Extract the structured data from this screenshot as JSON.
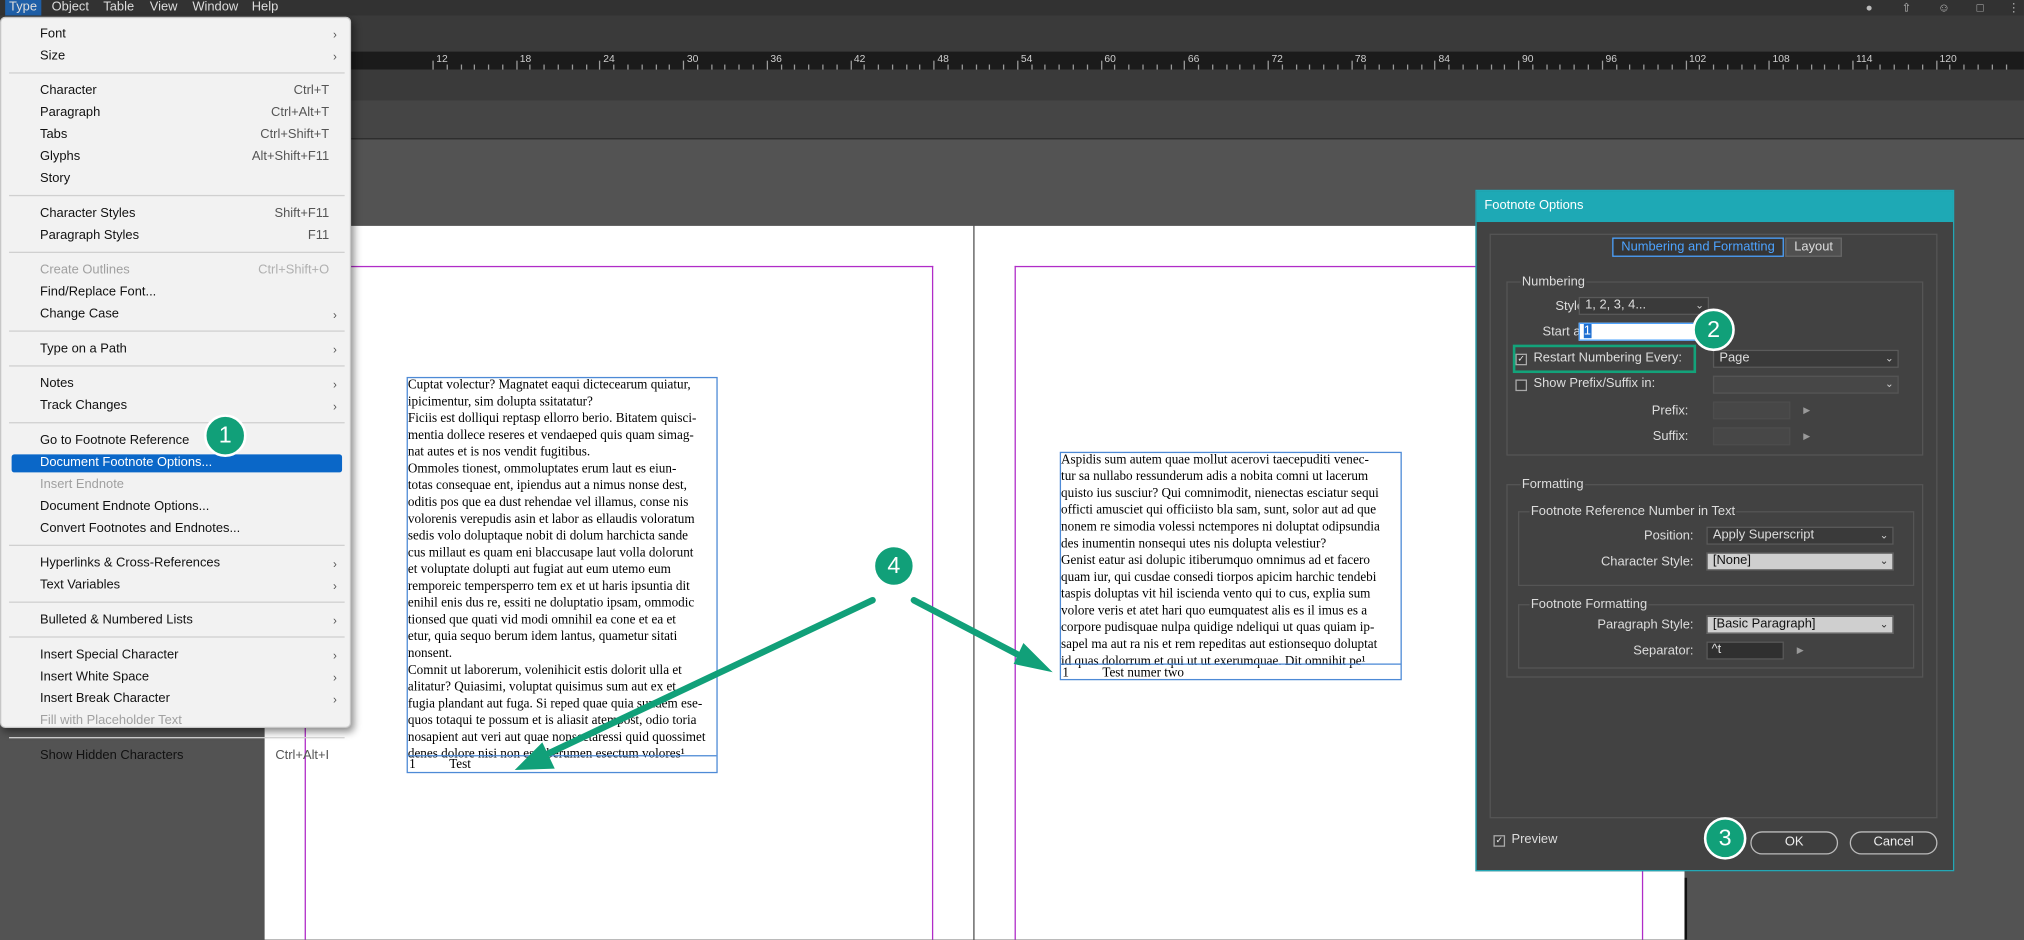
{
  "menubar": {
    "items": [
      "Type",
      "Object",
      "Table",
      "View",
      "Window",
      "Help"
    ]
  },
  "ruler": {
    "labels": [
      "12",
      "18",
      "24",
      "30",
      "36",
      "42",
      "48",
      "54",
      "60",
      "66",
      "72",
      "78",
      "84",
      "90",
      "96",
      "102",
      "108",
      "114",
      "120"
    ]
  },
  "type_menu": {
    "items": [
      {
        "label": "Font",
        "submenu": true
      },
      {
        "label": "Size",
        "submenu": true
      },
      {
        "divider": true
      },
      {
        "label": "Character",
        "shortcut": "Ctrl+T"
      },
      {
        "label": "Paragraph",
        "shortcut": "Ctrl+Alt+T"
      },
      {
        "label": "Tabs",
        "shortcut": "Ctrl+Shift+T"
      },
      {
        "label": "Glyphs",
        "shortcut": "Alt+Shift+F11"
      },
      {
        "label": "Story"
      },
      {
        "divider": true
      },
      {
        "label": "Character Styles",
        "shortcut": "Shift+F11"
      },
      {
        "label": "Paragraph Styles",
        "shortcut": "F11"
      },
      {
        "divider": true
      },
      {
        "label": "Create Outlines",
        "shortcut": "Ctrl+Shift+O",
        "disabled": true
      },
      {
        "label": "Find/Replace Font..."
      },
      {
        "label": "Change Case",
        "submenu": true
      },
      {
        "divider": true
      },
      {
        "label": "Type on a Path",
        "submenu": true
      },
      {
        "divider": true
      },
      {
        "label": "Notes",
        "submenu": true
      },
      {
        "label": "Track Changes",
        "submenu": true
      },
      {
        "divider": true
      },
      {
        "label": "Go to Footnote Reference"
      },
      {
        "label": "Document Footnote Options...",
        "highlighted": true
      },
      {
        "label": "Insert Endnote",
        "disabled": true
      },
      {
        "label": "Document Endnote Options..."
      },
      {
        "label": "Convert Footnotes and Endnotes..."
      },
      {
        "divider": true
      },
      {
        "label": "Hyperlinks & Cross-References",
        "submenu": true
      },
      {
        "label": "Text Variables",
        "submenu": true
      },
      {
        "divider": true
      },
      {
        "label": "Bulleted & Numbered Lists",
        "submenu": true
      },
      {
        "divider": true
      },
      {
        "label": "Insert Special Character",
        "submenu": true
      },
      {
        "label": "Insert White Space",
        "submenu": true
      },
      {
        "label": "Insert Break Character",
        "submenu": true
      },
      {
        "label": "Fill with Placeholder Text",
        "disabled": true
      },
      {
        "divider": true
      },
      {
        "label": "Show Hidden Characters",
        "shortcut": "Ctrl+Alt+I"
      }
    ]
  },
  "left_page": {
    "text": "Cuptat volectur? Magnatet eaqui dictecearum quiatur,\nipicimentur, sim dolupta ssitatatur?\nFiciis est dolliqui reptasp ellorro berio. Bitatem quisci-\nmentia dollece reseres et vendaeped quis quam simag-\nnat autes et is nos vendit fugitibus.\nOmmoles tionest, ommoluptates erum laut es eiun-\ntotas consequae ent, ipiendus aut a nimus nonse dest,\noditis pos que ea dust rehendae vel illamus, conse nis\nvolorenis verepudis asin et labor as ellaudis voloratum\nsedis volo doluptaque nobit di dolum harchicta sande\ncus millaut es quam eni blaccusape laut volla dolorunt\net voluptate dolupti aut fugiat aut eum utemo eum\nremporeic tempersperro tem ex et ut haris ipsuntia dit\nenihil enis dus re, essiti ne doluptatio ipsam, ommodic\ntionsed que quati vid modi omnihil ea cone et ea et\netur, quia sequo berum idem lantus, quametur sitati\nnonsent.\nComnit ut laborerum, volenihicit estis dolorit ulla et\nalitatur? Quiasimi, voluptat quisimus sum aut ex et\nfugia plandant aut fuga. Si reped quae quia sundem ese-\nquos totaqui te possum et is aliasit atempost, odio toria\nnosapient aut veri aut quae nonsectaressi quid quossimet\ndenes dolore nisi non essi berumen esectum volores¹",
    "footnote_num": "1",
    "footnote_text": "Test"
  },
  "right_page": {
    "text": "Aspidis sum autem quae mollut acerovi taecepuditi venec-\ntur sa nullabo ressunderum adis a nobita comni ut lacerum\nquisto ius susciur? Qui comnimodit, nienectas esciatur sequi\nofficti amusciet qui officiisto bla sam, sunt, solor aut ad que\nnonem re simodia volessi nctempores ni doluptat odipsundia\ndes inumentin nonsequi utes nis dolupta velestiur?\nGenist eatur asi dolupic itiberumquo omnimus ad et facero\nquam iur, qui cusdae consedi tiorpos apicim harchic tendebi\ntaspis doluptas vit hil iscienda vento qui to cus, explia sum\nvolore veris et atet hari quo eumquatest alis es il imus es a\ncorpore pudisquae nulpa quidige ndeliqui ut quas quiam ip-\nsapel ma aut ra nis et rem repeditas aut estionsequo doluptat\nid quas dolorrum et qui ut ut exerumquae. Dit omnihit pe¹",
    "footnote_num": "1",
    "footnote_text": "Test numer two"
  },
  "dialog": {
    "title": "Footnote Options",
    "tabs": [
      "Numbering and Formatting",
      "Layout"
    ],
    "numbering": {
      "group_label": "Numbering",
      "style_label": "Style:",
      "style_value": "1, 2, 3, 4...",
      "start_label": "Start at:",
      "start_value": "1",
      "restart_label": "Restart Numbering Every:",
      "restart_checked": true,
      "restart_value": "Page",
      "prefix_suffix_label": "Show Prefix/Suffix in:",
      "prefix_suffix_checked": false,
      "prefix_label": "Prefix:",
      "suffix_label": "Suffix:"
    },
    "formatting": {
      "group_label": "Formatting",
      "ref_group_label": "Footnote Reference Number in Text",
      "position_label": "Position:",
      "position_value": "Apply Superscript",
      "char_style_label": "Character Style:",
      "char_style_value": "[None]",
      "fn_group_label": "Footnote Formatting",
      "para_style_label": "Paragraph Style:",
      "para_style_value": "[Basic Paragraph]",
      "separator_label": "Separator:",
      "separator_value": "^t"
    },
    "preview_label": "Preview",
    "preview_checked": true,
    "ok_label": "OK",
    "cancel_label": "Cancel"
  },
  "annotations": [
    "1",
    "2",
    "3",
    "4"
  ],
  "colors": {
    "annotation": "#11a079",
    "dialog_title_bar": "#1ea9b5",
    "menu_highlight": "#0a67c8",
    "margin_guide": "#b02cc8",
    "frame_edge": "#4d8ad6"
  }
}
